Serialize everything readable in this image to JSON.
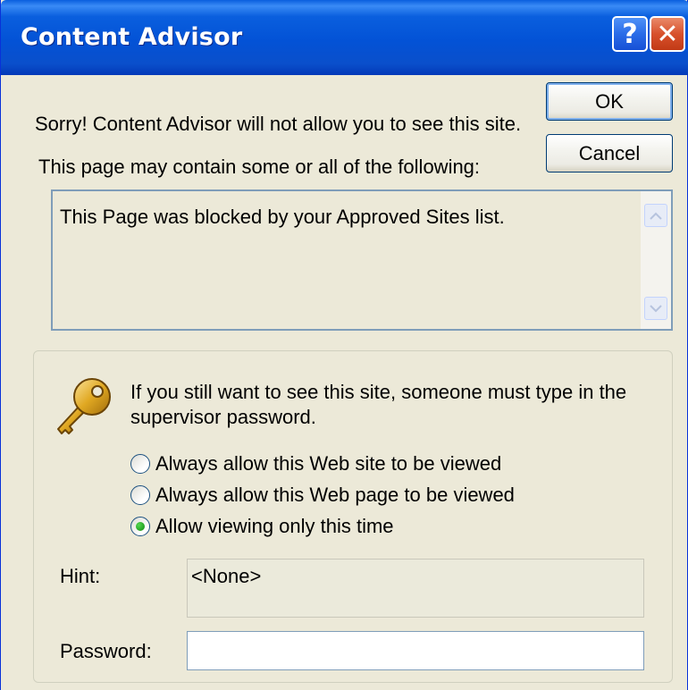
{
  "window": {
    "title": "Content Advisor",
    "help_glyph": "?",
    "close_glyph": "✕"
  },
  "message": "Sorry! Content Advisor will not allow you to see this site.",
  "buttons": {
    "ok": "OK",
    "cancel": "Cancel"
  },
  "contents_label": "This page may contain some or all of the following:",
  "contents_text": "This Page was blocked by your Approved Sites list.",
  "supervisor": {
    "instructions_line1": "If you still want to see this site, someone must type in the",
    "instructions_line2": "supervisor password.",
    "options": [
      {
        "label": "Always allow this Web site to be viewed",
        "checked": false
      },
      {
        "label": "Always allow this Web page to be viewed",
        "checked": false
      },
      {
        "label": "Allow viewing only this time",
        "checked": true
      }
    ],
    "hint_label": "Hint:",
    "hint_value": "<None>",
    "password_label": "Password:",
    "password_value": ""
  },
  "colors": {
    "titlebar": "#0352d6",
    "dialog_bg": "#ece9d8",
    "close_button": "#d8512c",
    "help_button": "#2a6ce8"
  },
  "icons": {
    "help": "help-icon",
    "close": "close-icon",
    "key": "key-icon",
    "scroll_up": "scroll-up-arrow-icon",
    "scroll_down": "scroll-down-arrow-icon"
  }
}
